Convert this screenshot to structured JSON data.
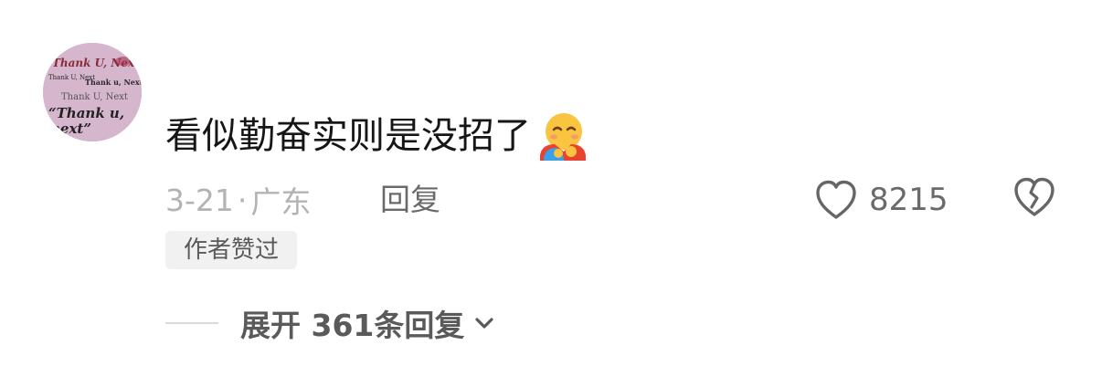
{
  "comment": {
    "avatar_texts": [
      "Thank U, Next",
      "Thank U, Next",
      "Thank u, Next",
      "Thank U, Next",
      "“Thank u,",
      "next”"
    ],
    "text": "看似勤奋实则是没招了",
    "emoji": "hugging-face-emoji",
    "date": "3-21",
    "separator": "·",
    "location": "广东",
    "reply_label": "回复",
    "like_count": "8215",
    "author_badge": "作者赞过",
    "expand_label": "展开 361条回复"
  },
  "colors": {
    "text_primary": "#161616",
    "text_meta": "#b3b3b3",
    "text_secondary": "#6a6a6a",
    "badge_bg": "#f1f1f1",
    "avatar_bg": "#d7b9cf"
  },
  "icons": {
    "like": "heart-outline-icon",
    "dislike": "broken-heart-icon",
    "expand": "chevron-down-icon"
  }
}
